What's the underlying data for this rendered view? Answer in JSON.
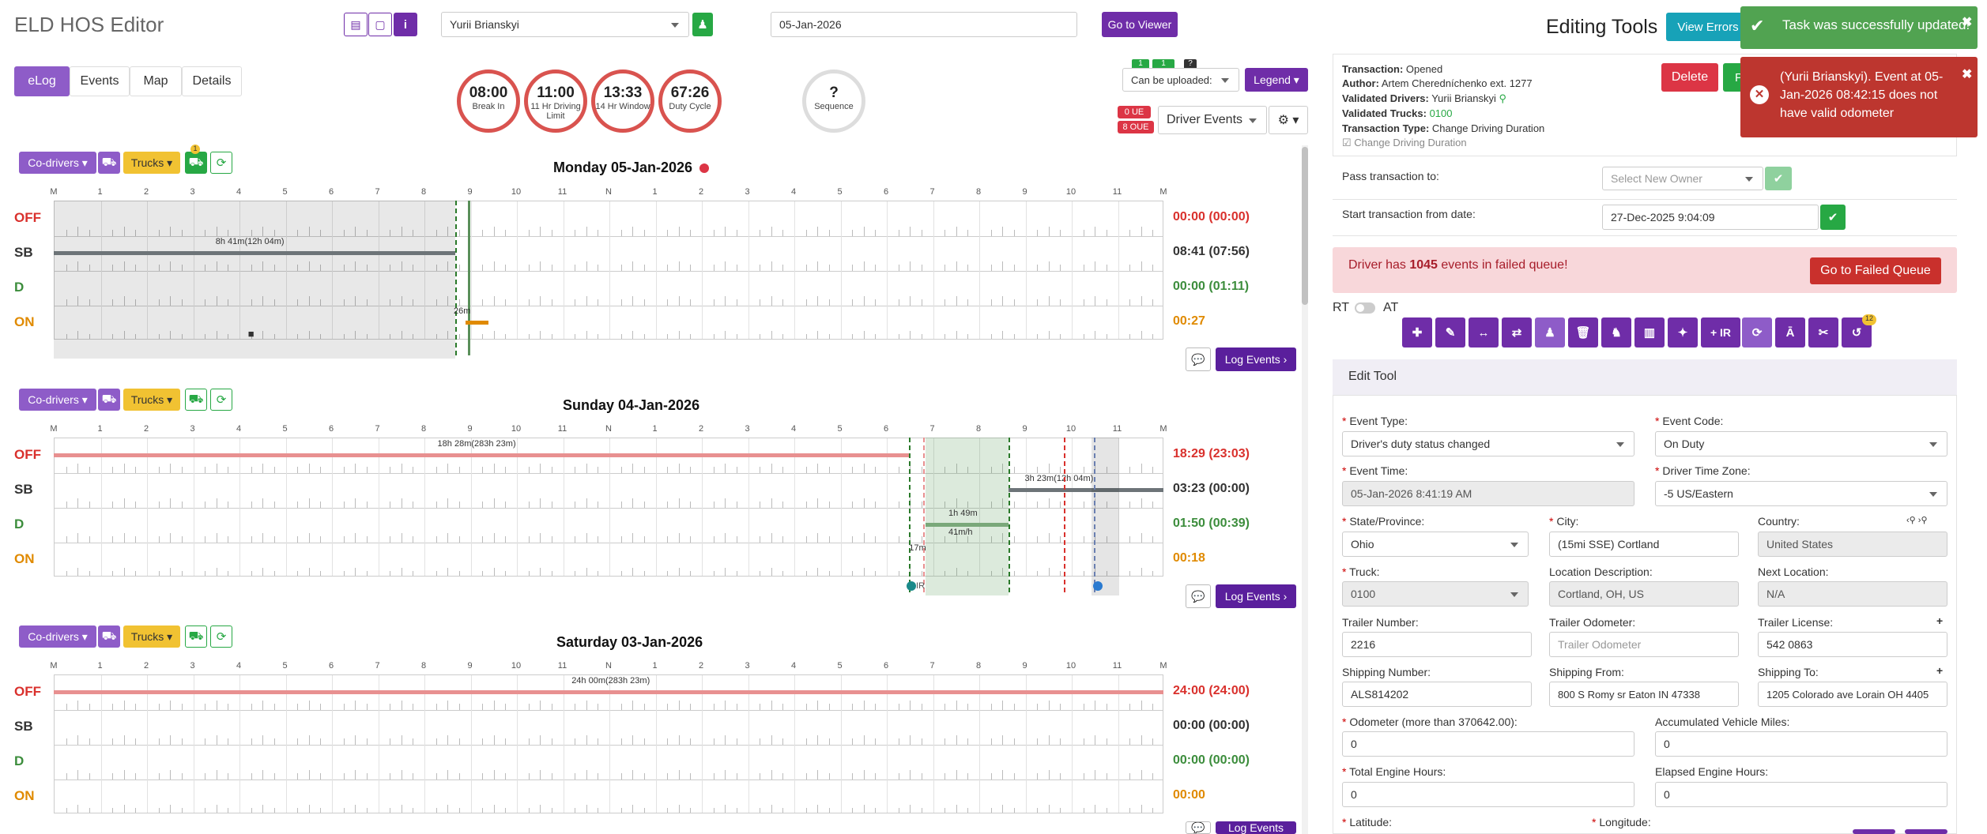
{
  "app": {
    "title": "ELD HOS Editor",
    "driver": "Yurii Brianskyi",
    "date": "05-Jan-2026",
    "go_to_viewer": "Go to Viewer"
  },
  "tabs": [
    "eLog",
    "Events",
    "Map",
    "Details"
  ],
  "gauges": [
    {
      "value": "08:00",
      "label": "Break In"
    },
    {
      "value": "11:00",
      "label": "11 Hr Driving Limit"
    },
    {
      "value": "13:33",
      "label": "14 Hr Window"
    },
    {
      "value": "67:26",
      "label": "Duty Cycle"
    },
    {
      "value": "?",
      "label": "Sequence"
    }
  ],
  "upload": {
    "badges": [
      "1",
      "1",
      "?"
    ],
    "select": "Can be uploaded:",
    "legend": "Legend",
    "ue": "0 UE",
    "oue": "8 OUE",
    "driver_events": "Driver Events"
  },
  "controls": {
    "codrivers": "Co-drivers",
    "trucks": "Trucks",
    "log_events": "Log Events",
    "badge": "1"
  },
  "hours": [
    "M",
    "1",
    "2",
    "3",
    "4",
    "5",
    "6",
    "7",
    "8",
    "9",
    "10",
    "11",
    "N",
    "1",
    "2",
    "3",
    "4",
    "5",
    "6",
    "7",
    "8",
    "9",
    "10",
    "11",
    "M"
  ],
  "rows": [
    "OFF",
    "SB",
    "D",
    "ON"
  ],
  "days": [
    {
      "title": "Monday 05-Jan-2026",
      "totals": [
        "00:00 (00:00)",
        "08:41 (07:56)",
        "00:00 (01:11)",
        "00:27"
      ],
      "labels": [
        "8h 41m(12h 04m)",
        "26m"
      ]
    },
    {
      "title": "Sunday 04-Jan-2026",
      "totals": [
        "18:29 (23:03)",
        "03:23 (00:00)",
        "01:50 (00:39)",
        "00:18"
      ],
      "labels": [
        "18h 28m(283h 23m)",
        "3h 23m(12h 04m)",
        "1h 49m",
        "41m/h",
        "17m",
        "IR"
      ]
    },
    {
      "title": "Saturday 03-Jan-2026",
      "totals": [
        "24:00 (24:00)",
        "00:00 (00:00)",
        "00:00 (00:00)",
        "00:00"
      ],
      "labels": [
        "24h 00m(283h 23m)"
      ]
    }
  ],
  "editing": {
    "title": "Editing Tools",
    "view_errors": "View Errors",
    "delete": "Delete",
    "info": {
      "transaction": "Opened",
      "author": "Artem Cheredníchenko ext. 1277",
      "validated_drivers": "Yurii Brianskyi",
      "validated_trucks": "0100",
      "transaction_type": "Change Driving Duration",
      "checkbox": "Change Driving Duration"
    },
    "info_labels": {
      "transaction": "Transaction:",
      "author": "Author:",
      "validated_drivers": "Validated Drivers:",
      "validated_trucks": "Validated Trucks:",
      "transaction_type": "Transaction Type:"
    },
    "pass_to": "Pass transaction to:",
    "pass_placeholder": "Select New Owner",
    "start_from": "Start transaction from date:",
    "start_date": "27-Dec-2025 9:04:09",
    "failed_pre": "Driver has ",
    "failed_count": "1045",
    "failed_post": " events in failed queue!",
    "failed_btn": "Go to Failed Queue",
    "rt": "RT",
    "at": "AT",
    "ir_btn": "+ IR",
    "tool_badge": "12",
    "edit_tool": "Edit Tool"
  },
  "form": {
    "event_type": {
      "label": "Event Type:",
      "value": "Driver's duty status changed"
    },
    "event_code": {
      "label": "Event Code:",
      "value": "On Duty"
    },
    "event_time": {
      "label": "Event Time:",
      "value": "05-Jan-2026 8:41:19 AM"
    },
    "driver_tz": {
      "label": "Driver Time Zone:",
      "value": "-5 US/Eastern"
    },
    "state": {
      "label": "State/Province:",
      "value": "Ohio"
    },
    "city": {
      "label": "City:",
      "value": "(15mi SSE) Cortland"
    },
    "country": {
      "label": "Country:",
      "value": "United States"
    },
    "truck": {
      "label": "Truck:",
      "value": "0100"
    },
    "location_desc": {
      "label": "Location Description:",
      "value": "Cortland, OH, US"
    },
    "next_location": {
      "label": "Next Location:",
      "value": "N/A"
    },
    "trailer_number": {
      "label": "Trailer Number:",
      "value": "2216"
    },
    "trailer_odometer": {
      "label": "Trailer Odometer:",
      "placeholder": "Trailer Odometer"
    },
    "trailer_license": {
      "label": "Trailer License:",
      "value": "542 0863"
    },
    "shipping_number": {
      "label": "Shipping Number:",
      "value": "ALS814202"
    },
    "shipping_from": {
      "label": "Shipping From:",
      "value": "800 S Romy sr Eaton IN 47338"
    },
    "shipping_to": {
      "label": "Shipping To:",
      "value": "1205 Colorado ave Lorain OH 4405"
    },
    "odometer": {
      "label": "Odometer (more than 370642.00):",
      "value": "0"
    },
    "accum_miles": {
      "label": "Accumulated Vehicle Miles:",
      "value": "0"
    },
    "engine_hours": {
      "label": "Total Engine Hours:",
      "value": "0"
    },
    "elapsed_hours": {
      "label": "Elapsed Engine Hours:",
      "value": "0"
    },
    "latitude": {
      "label": "Latitude:"
    },
    "longitude": {
      "label": "Longitude:"
    }
  },
  "toasts": {
    "success": "Task was successfully updated!",
    "error": "(Yurii Brianskyi). Event at 05-Jan-2026 08:42:15 does not have valid odometer"
  },
  "colors": {
    "purple": "#6f2da8",
    "green": "#27a844",
    "red": "#dc3545",
    "amber": "#f1c232",
    "off": "#d9302c",
    "sb": "#333333",
    "d": "#3c8d3c",
    "on": "#e08a00"
  }
}
